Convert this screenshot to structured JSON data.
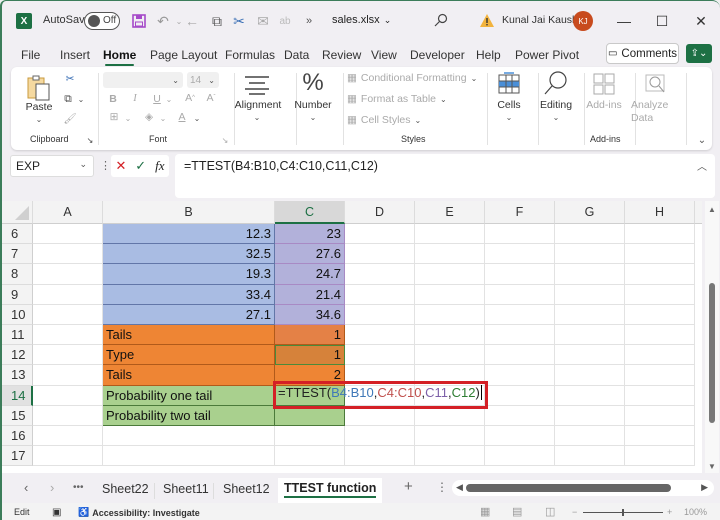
{
  "titlebar": {
    "app_icon": "excel-logo-icon",
    "app_letter": "X",
    "autosave_label": "AutoSave",
    "autosave_state": "Off",
    "filename": "sales.xlsx",
    "filename_chevron": "⌄",
    "user_name": "Kunal Jai Kaushik",
    "user_initials": "KJ",
    "quick_access": [
      "save-icon",
      "undo-icon",
      "back-icon",
      "clipboard-icon",
      "cut-icon",
      "email-icon",
      "spelling-icon",
      "more-icon"
    ]
  },
  "menu": {
    "items": [
      "File",
      "Insert",
      "Home",
      "Page Layout",
      "Formulas",
      "Data",
      "Review",
      "View",
      "Developer",
      "Help",
      "Power Pivot"
    ],
    "active": "Home",
    "comments_label": "Comments"
  },
  "ribbon": {
    "clipboard": {
      "paste_label": "Paste",
      "group_label": "Clipboard"
    },
    "font": {
      "font_name": "",
      "font_size": "14",
      "group_label": "Font",
      "bold": "B",
      "italic": "I",
      "underline": "U"
    },
    "alignment_label": "Alignment",
    "number_label": "Number",
    "styles": {
      "conditional_formatting": "Conditional Formatting",
      "format_as_table": "Format as Table",
      "cell_styles": "Cell Styles",
      "group_label": "Styles"
    },
    "cells_label": "Cells",
    "editing_label": "Editing",
    "addins_label": "Add-ins",
    "analyze_data_label": "Analyze Data",
    "addins_group_label": "Add-ins"
  },
  "formula_bar": {
    "name_box": "EXP",
    "formula": "=TTEST(B4:B10,C4:C10,C11,C12)",
    "cancel_icon": "✕",
    "enter_icon": "✓",
    "fx_label": "fx"
  },
  "grid": {
    "columns": [
      "A",
      "B",
      "C",
      "D",
      "E",
      "F",
      "G",
      "H"
    ],
    "selected_column": "C",
    "rows": [
      {
        "n": "6",
        "b": "12.3",
        "c": "23"
      },
      {
        "n": "7",
        "b": "32.5",
        "c": "27.6"
      },
      {
        "n": "8",
        "b": "19.3",
        "c": "24.7"
      },
      {
        "n": "9",
        "b": "33.4",
        "c": "21.4"
      },
      {
        "n": "10",
        "b": "27.1",
        "c": "34.6"
      },
      {
        "n": "11",
        "b": "Tails",
        "c": "1"
      },
      {
        "n": "12",
        "b": "Type",
        "c": "1"
      },
      {
        "n": "13",
        "b": "Tails",
        "c": "2"
      },
      {
        "n": "14",
        "b": "Probability one tail",
        "c": ""
      },
      {
        "n": "15",
        "b": "Probability two tail",
        "c": ""
      },
      {
        "n": "16",
        "b": "",
        "c": ""
      },
      {
        "n": "17",
        "b": "",
        "c": ""
      }
    ],
    "editing_cell": {
      "ref": "C14",
      "parts": [
        "=TTEST(",
        "B4:B10",
        ",",
        "C4:C10",
        ",",
        "C11",
        ",",
        "C12",
        ")"
      ]
    }
  },
  "sheets": {
    "tabs": [
      "Sheet22",
      "Sheet11",
      "Sheet12",
      "TTEST function"
    ],
    "active": "TTEST function",
    "more": "•••",
    "add": "+"
  },
  "status": {
    "mode": "Edit",
    "accessibility": "Accessibility: Investigate",
    "zoom": "100%"
  },
  "colors": {
    "accent": "#1d7044",
    "blue_fill": "#a9bce3",
    "orange_fill": "#ee8534",
    "green_fill": "#a9d08e",
    "edit_highlight": "#d42026"
  }
}
